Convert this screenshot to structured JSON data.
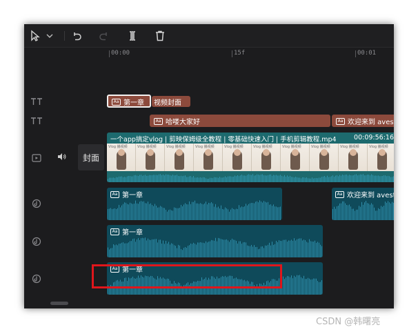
{
  "toolbar": {
    "tools": [
      {
        "name": "select-tool-icon"
      },
      {
        "name": "undo-icon"
      },
      {
        "name": "redo-icon"
      },
      {
        "name": "split-icon"
      },
      {
        "name": "delete-icon"
      }
    ]
  },
  "ruler": {
    "ticks": [
      "00:00",
      "15f",
      "00:01"
    ]
  },
  "tracks": {
    "text1": {
      "chapter_label": "第一章",
      "cover_label": "视频封面"
    },
    "text2": {
      "clip_a": "哈喽大家好",
      "clip_b": "欢迎来到 avest"
    },
    "video": {
      "title": "一个app搞定vlog | 剪映保姆级全教程 | 零基础快速入门 | 手机剪辑教程.mp4",
      "duration": "00:09:56:16",
      "frame_text": "Vlog 播视频",
      "cover_button": "封面"
    },
    "audio1": {
      "label_a": "第一章",
      "label_b": "欢迎来到 avest"
    },
    "audio2": {
      "label": "第一章"
    },
    "audio3": {
      "label": "第一章"
    }
  },
  "tag_text": "Aa",
  "colors": {
    "text_clip": "#8c4a3c",
    "audio_clip": "#0f4a5a",
    "video_clip": "#1d6a6e",
    "highlight": "#e0161b",
    "wave": "#3aa7c8"
  },
  "watermark": "CSDN @韩曙亮"
}
